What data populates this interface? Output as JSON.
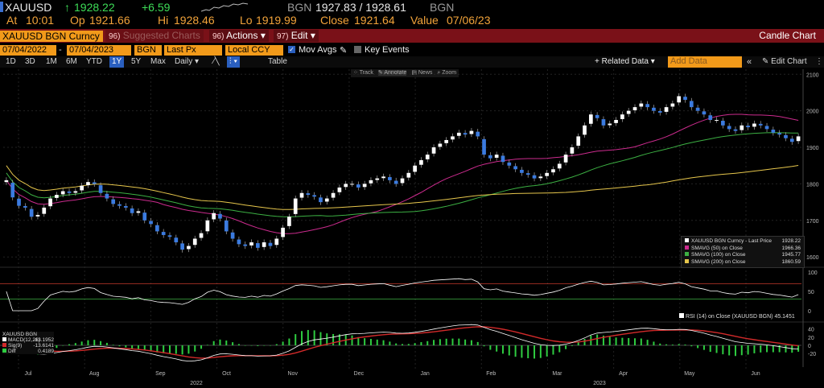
{
  "header": {
    "ticker": "XAUUSD",
    "last": "1928.22",
    "change": "+6.59",
    "source": "BGN",
    "bid_ask": "1927.83 / 1928.61",
    "bid_ask_src": "BGN",
    "at_label": "At",
    "at_time": "10:01",
    "op_label": "Op",
    "op": "1921.66",
    "hi_label": "Hi",
    "hi": "1928.46",
    "lo_label": "Lo",
    "lo": "1919.99",
    "close_label": "Close",
    "close": "1921.64",
    "value_label": "Value",
    "value_date": "07/06/23"
  },
  "toolbar": {
    "security": "XAUUSD BGN Curncy",
    "suggested_num": "96)",
    "suggested": "Suggested Charts",
    "actions_num": "96)",
    "actions": "Actions",
    "edit_num": "97)",
    "edit": "Edit",
    "chart_type": "Candle Chart"
  },
  "params": {
    "start_date": "07/04/2022",
    "end_date": "07/04/2023",
    "source": "BGN",
    "field": "Last Px",
    "currency": "Local CCY",
    "mov_avgs": "Mov Avgs",
    "key_events": "Key Events"
  },
  "ranges": {
    "items": [
      "1D",
      "3D",
      "1M",
      "6M",
      "YTD",
      "1Y",
      "5Y",
      "Max"
    ],
    "active": "1Y",
    "freq": "Daily",
    "table": "Table",
    "related": "Related Data",
    "add_data": "Add Data",
    "edit_chart": "Edit Chart"
  },
  "chart_tools": [
    "Track",
    "Annotate",
    "News",
    "Zoom"
  ],
  "chart_data": {
    "type": "line",
    "title": "",
    "x_months": [
      "Jul",
      "Aug",
      "Sep",
      "Oct",
      "Nov",
      "Dec",
      "Jan",
      "Feb",
      "Mar",
      "Apr",
      "May",
      "Jun"
    ],
    "x_years": [
      "2022",
      "2023"
    ],
    "price_axis": [
      2100,
      2000,
      1900,
      1800,
      1700,
      1600
    ],
    "price_ylim": [
      1585,
      2105
    ],
    "rsi_axis": [
      100,
      50,
      0
    ],
    "macd_axis": [
      40,
      20,
      0,
      -20
    ],
    "price_series": {
      "name": "XAUUSD BGN Curncy - Last Price",
      "values": [
        1810,
        1763,
        1740,
        1735,
        1710,
        1715,
        1735,
        1760,
        1770,
        1780,
        1775,
        1780,
        1795,
        1805,
        1800,
        1775,
        1760,
        1745,
        1740,
        1735,
        1720,
        1725,
        1700,
        1690,
        1670,
        1660,
        1655,
        1640,
        1620,
        1630,
        1650,
        1665,
        1700,
        1720,
        1705,
        1670,
        1650,
        1635,
        1630,
        1640,
        1625,
        1640,
        1630,
        1650,
        1680,
        1710,
        1760,
        1775,
        1770,
        1765,
        1750,
        1760,
        1775,
        1790,
        1800,
        1800,
        1790,
        1800,
        1810,
        1815,
        1820,
        1810,
        1800,
        1815,
        1830,
        1850,
        1865,
        1880,
        1900,
        1910,
        1920,
        1930,
        1940,
        1935,
        1945,
        1930,
        1880,
        1870,
        1880,
        1860,
        1850,
        1840,
        1830,
        1825,
        1815,
        1820,
        1830,
        1840,
        1855,
        1880,
        1900,
        1930,
        1960,
        1990,
        1980,
        1960,
        1965,
        1975,
        1990,
        2000,
        2010,
        2020,
        2010,
        2000,
        1995,
        2010,
        2020,
        2040,
        2030,
        2010,
        2000,
        1990,
        1975,
        1975,
        1960,
        1950,
        1945,
        1960,
        1955,
        1965,
        1960,
        1950,
        1940,
        1935,
        1925,
        1915,
        1930
      ]
    },
    "series": [
      {
        "name": "XAUUSD BGN Curncy - Last Price",
        "value": "1928.22",
        "color": "#ffffff"
      },
      {
        "name": "SMAVG (50) on Close",
        "value": "1966.36",
        "color": "#cc2b8e"
      },
      {
        "name": "SMAVG (100) on Close",
        "value": "1945.77",
        "color": "#3cb043"
      },
      {
        "name": "SMAVG (200) on Close",
        "value": "1860.59",
        "color": "#e6c64c"
      }
    ],
    "rsi_label": "RSI (14) on Close (XAUUSD BGN)",
    "rsi_value": "45.1451",
    "macd_legend": {
      "title": "XAUUSD BGN",
      "items": [
        {
          "name": "MACD(12,26)",
          "value": "-13.1952",
          "color": "#ffffff"
        },
        {
          "name": "Sig(9)",
          "value": "-13.6141",
          "color": "#d22a2a"
        },
        {
          "name": "Diff",
          "value": "0.4189",
          "color": "#2ecc40"
        }
      ]
    }
  }
}
